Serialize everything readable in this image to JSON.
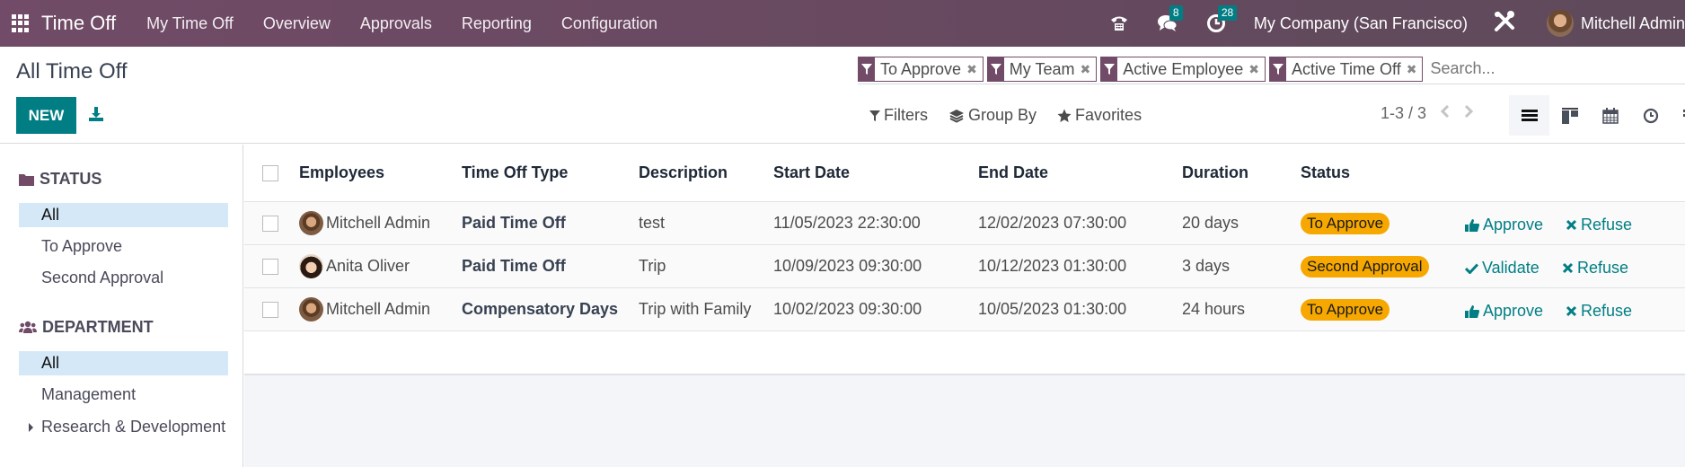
{
  "navbar": {
    "app_name": "Time Off",
    "menu": [
      "My Time Off",
      "Overview",
      "Approvals",
      "Reporting",
      "Configuration"
    ],
    "messages_count": "8",
    "activities_count": "28",
    "company": "My Company (San Francisco)",
    "user": "Mitchell Admin"
  },
  "control_panel": {
    "title": "All Time Off",
    "new_label": "NEW",
    "facets": [
      "To Approve",
      "My Team",
      "Active Employee",
      "Active Time Off"
    ],
    "search_placeholder": "Search...",
    "filters_label": "Filters",
    "group_by_label": "Group By",
    "favorites_label": "Favorites",
    "pager": "1-3 / 3",
    "views": [
      "list",
      "kanban",
      "calendar",
      "activity",
      "gantt"
    ],
    "active_view": "list"
  },
  "sidebar": {
    "status": {
      "title": "STATUS",
      "items": [
        "All",
        "To Approve",
        "Second Approval"
      ],
      "active": "All"
    },
    "department": {
      "title": "DEPARTMENT",
      "items": [
        "All",
        "Management",
        "Research & Development"
      ],
      "active": "All"
    }
  },
  "table": {
    "columns": [
      "Employees",
      "Time Off Type",
      "Description",
      "Start Date",
      "End Date",
      "Duration",
      "Status"
    ],
    "rows": [
      {
        "employee": "Mitchell Admin",
        "type": "Paid Time Off",
        "description": "test",
        "start": "11/05/2023 22:30:00",
        "end": "12/02/2023 07:30:00",
        "duration": "20 days",
        "status": "To Approve",
        "action1": "Approve",
        "action2": "Refuse"
      },
      {
        "employee": "Anita Oliver",
        "type": "Paid Time Off",
        "description": "Trip",
        "start": "10/09/2023 09:30:00",
        "end": "10/12/2023 01:30:00",
        "duration": "3 days",
        "status": "Second Approval",
        "action1": "Validate",
        "action2": "Refuse"
      },
      {
        "employee": "Mitchell Admin",
        "type": "Compensatory Days",
        "description": "Trip with Family",
        "start": "10/02/2023 09:30:00",
        "end": "10/05/2023 01:30:00",
        "duration": "24 hours",
        "status": "To Approve",
        "action1": "Approve",
        "action2": "Refuse"
      }
    ]
  },
  "colors": {
    "brand": "#714b67",
    "primary": "#017e84",
    "status_badge": "#f6a800",
    "sidebar_active": "#d4e8f8"
  }
}
